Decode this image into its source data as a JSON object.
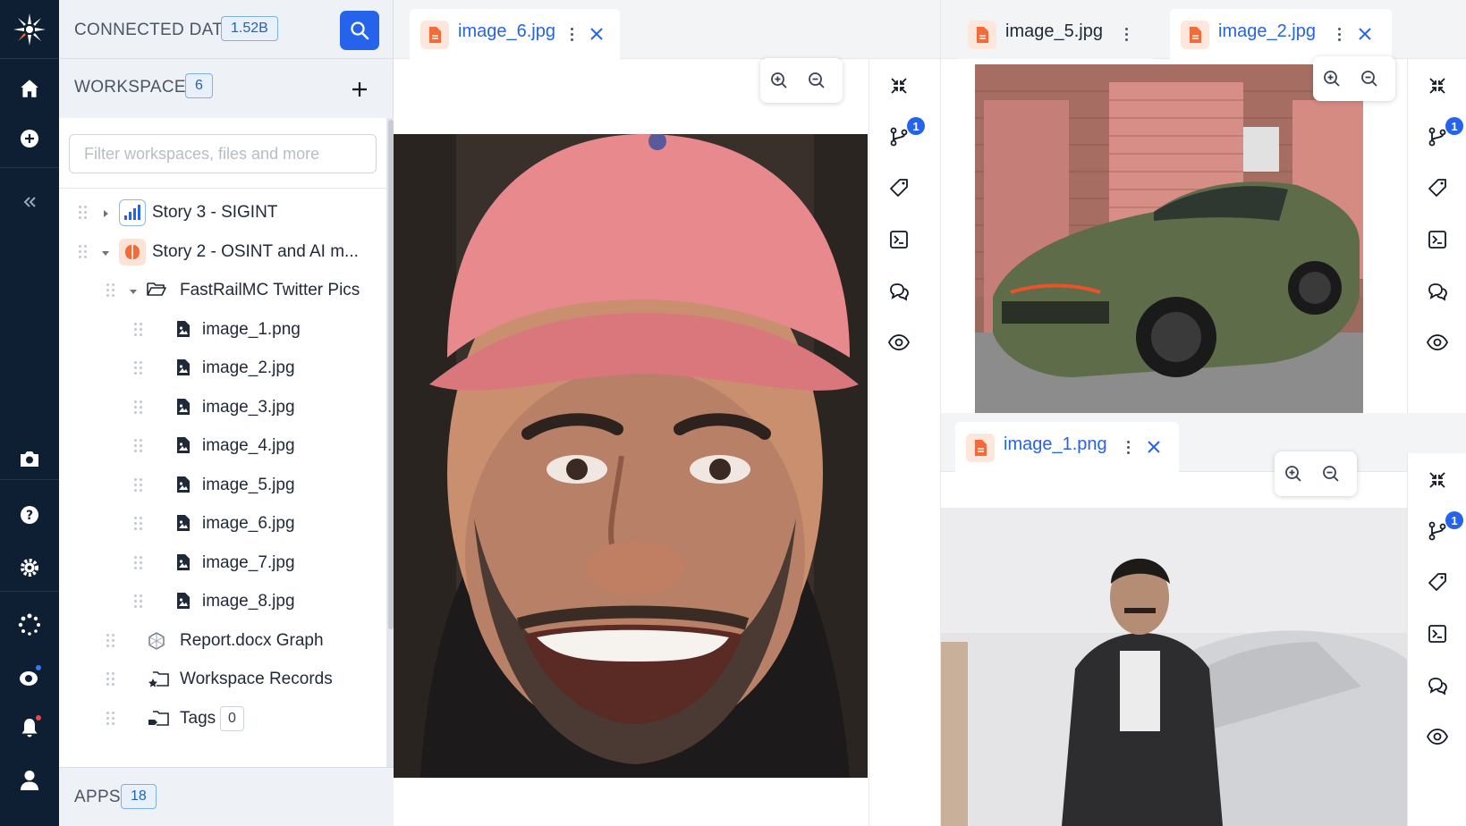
{
  "sidebar": {
    "connected_title": "CONNECTED DATA",
    "connected_count": "1.52B",
    "workspaces_title": "WORKSPACES",
    "workspaces_count": "6",
    "filter_placeholder": "Filter workspaces, files and more",
    "tree": [
      {
        "label": "Story 3 - SIGINT",
        "icon": "signal-bars-icon"
      },
      {
        "label": "Story 2 - OSINT and AI m...",
        "icon": "brain-icon"
      },
      {
        "label": "FastRailMC Twitter Pics",
        "icon": "folder-open-icon"
      },
      {
        "label": "image_1.png",
        "icon": "image-file-icon"
      },
      {
        "label": "image_2.jpg",
        "icon": "image-file-icon"
      },
      {
        "label": "image_3.jpg",
        "icon": "image-file-icon"
      },
      {
        "label": "image_4.jpg",
        "icon": "image-file-icon"
      },
      {
        "label": "image_5.jpg",
        "icon": "image-file-icon"
      },
      {
        "label": "image_6.jpg",
        "icon": "image-file-icon"
      },
      {
        "label": "image_7.jpg",
        "icon": "image-file-icon"
      },
      {
        "label": "image_8.jpg",
        "icon": "image-file-icon"
      },
      {
        "label": "Report.docx Graph",
        "icon": "graph-icon"
      },
      {
        "label": "Workspace Records",
        "icon": "folder-star-icon"
      },
      {
        "label": "Tags",
        "icon": "folder-tag-icon",
        "count": "0"
      }
    ],
    "apps_title": "APPS",
    "apps_count": "18"
  },
  "panes": {
    "left": {
      "tab": "image_6.jpg",
      "badge": "1"
    },
    "top_right": {
      "tab_inactive": "image_5.jpg",
      "tab_active": "image_2.jpg",
      "badge": "1"
    },
    "bottom_right": {
      "tab": "image_1.png",
      "badge": "1"
    }
  },
  "colors": {
    "rail": "#0f1f33",
    "accent": "#2563eb",
    "file_icon": "#f26b3a",
    "notification": "#ef4444"
  }
}
